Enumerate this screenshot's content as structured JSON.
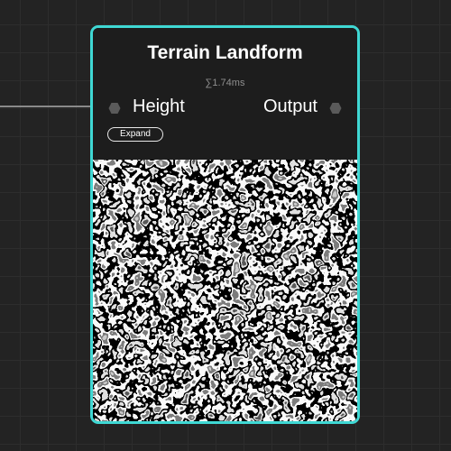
{
  "node": {
    "title": "Terrain Landform",
    "timing": "∑1.74ms",
    "input_label": "Height",
    "output_label": "Output",
    "expand_label": "Expand"
  },
  "colors": {
    "selection_outline": "#3fd8d4",
    "node_background": "#1d1d1d",
    "canvas_background": "#232323",
    "port": "#5a5a5a",
    "wire": "#8a8a8a"
  },
  "icons": {
    "input_port": "hexagon-port-icon",
    "output_port": "hexagon-port-icon"
  }
}
